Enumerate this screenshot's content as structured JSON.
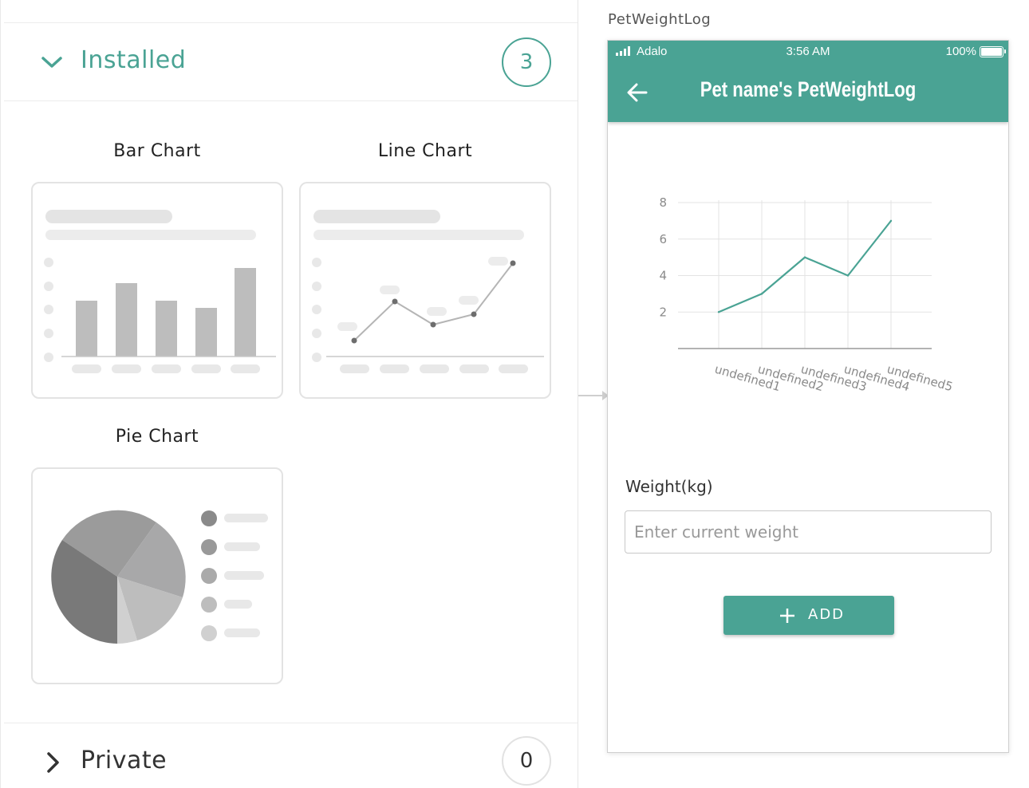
{
  "library": {
    "installed": {
      "title": "Installed",
      "count": "3",
      "components": [
        {
          "name": "Bar Chart"
        },
        {
          "name": "Line Chart"
        },
        {
          "name": "Pie Chart"
        }
      ]
    },
    "private": {
      "title": "Private",
      "count": "0"
    }
  },
  "screen": {
    "name": "PetWeightLog",
    "status_bar": {
      "carrier": "Adalo",
      "time": "3:56 AM",
      "battery": "100%"
    },
    "app_bar": {
      "title": "Pet name's PetWeightLog",
      "back_icon": "arrow-left-icon"
    },
    "form": {
      "label": "Weight(kg)",
      "placeholder": "Enter current weight",
      "button_label": "ADD",
      "button_icon": "plus-icon"
    }
  },
  "colors": {
    "accent": "#4aa394",
    "placeholder_gray": "#bdbdbd"
  },
  "chart_data": {
    "type": "line",
    "categories": [
      "undefined1",
      "undefined2",
      "undefined3",
      "undefined4",
      "undefined5"
    ],
    "values": [
      2,
      3,
      5,
      4,
      7
    ],
    "y_ticks": [
      "2",
      "4",
      "6",
      "8"
    ],
    "ylim": [
      0,
      8
    ],
    "grid": true,
    "line_color": "#4aa394"
  }
}
